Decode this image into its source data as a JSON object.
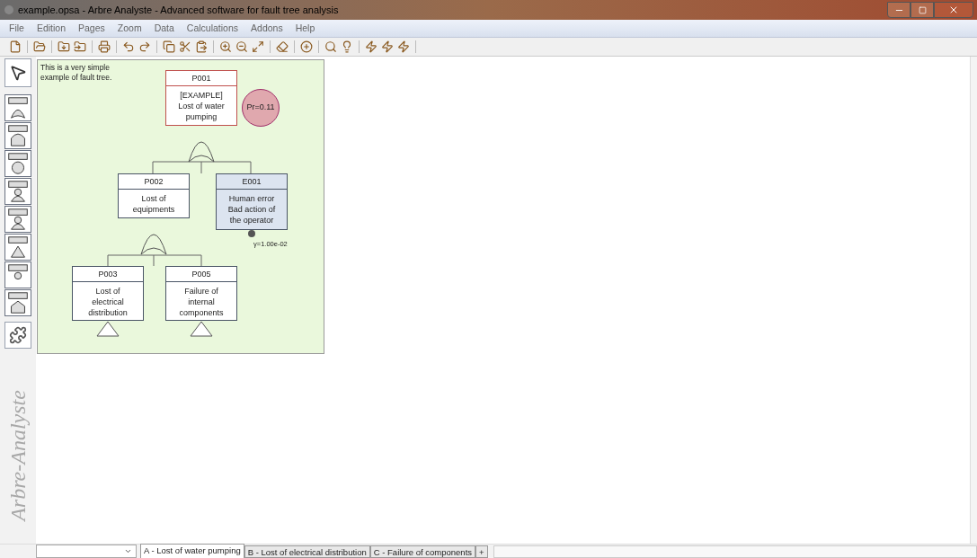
{
  "window": {
    "title": "example.opsa - Arbre Analyste - Advanced software for fault tree analysis"
  },
  "menu": [
    "File",
    "Edition",
    "Pages",
    "Zoom",
    "Data",
    "Calculations",
    "Addons",
    "Help"
  ],
  "sidebar": {
    "brand": "Arbre-Analyste"
  },
  "canvas": {
    "note": "This is a very simple example of fault tree.",
    "nodes": [
      {
        "kind": "top",
        "id": "P001",
        "label": "[EXAMPLE] Lost of water pumping"
      },
      {
        "kind": "gate",
        "id": "P002",
        "label": "Lost of equipments"
      },
      {
        "kind": "basic",
        "id": "E001",
        "label": "Human error Bad action of the operator"
      },
      {
        "kind": "gate",
        "id": "P003",
        "label": "Lost of electrical distribution"
      },
      {
        "kind": "gate",
        "id": "P005",
        "label": "Failure of internal components"
      }
    ],
    "probability": "Pr=0.11",
    "rate": "γ=1.00e-02"
  },
  "tabs": [
    {
      "label": "A - Lost of water pumping",
      "selected": true
    },
    {
      "label": "B - Lost of electrical distribution",
      "selected": false
    },
    {
      "label": "C - Failure of components",
      "selected": false
    }
  ],
  "add_tab": "+"
}
